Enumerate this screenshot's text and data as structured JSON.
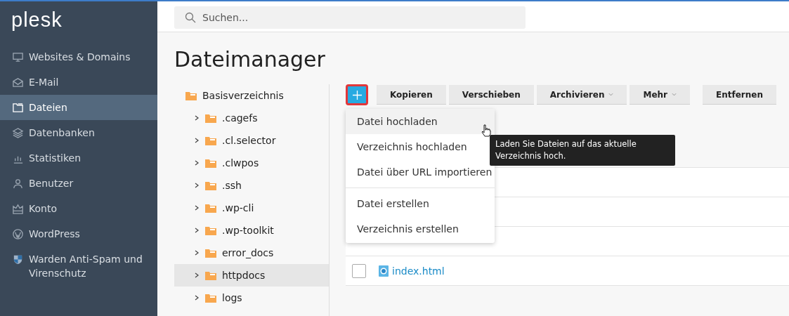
{
  "sidebar": {
    "logo": "plesk",
    "items": [
      {
        "label": "Websites & Domains",
        "selected": false
      },
      {
        "label": "E-Mail",
        "selected": false
      },
      {
        "label": "Dateien",
        "selected": true
      },
      {
        "label": "Datenbanken",
        "selected": false
      },
      {
        "label": "Statistiken",
        "selected": false
      },
      {
        "label": "Benutzer",
        "selected": false
      },
      {
        "label": "Konto",
        "selected": false
      },
      {
        "label": "WordPress",
        "selected": false
      },
      {
        "label": "Warden Anti-Spam und Virenschutz",
        "selected": false
      }
    ]
  },
  "search": {
    "placeholder": "Suchen..."
  },
  "page_title": "Dateimanager",
  "tree": {
    "label": "Basisverzeichnis",
    "selected": false,
    "children": [
      {
        "label": ".cagefs",
        "expanded": false,
        "selected": false
      },
      {
        "label": ".cl.selector",
        "expanded": false,
        "selected": false
      },
      {
        "label": ".clwpos",
        "expanded": false,
        "selected": false
      },
      {
        "label": ".ssh",
        "expanded": false,
        "selected": false
      },
      {
        "label": ".wp-cli",
        "expanded": false,
        "selected": false
      },
      {
        "label": ".wp-toolkit",
        "expanded": false,
        "selected": false
      },
      {
        "label": "error_docs",
        "expanded": false,
        "selected": false
      },
      {
        "label": "httpdocs",
        "expanded": false,
        "selected": true
      },
      {
        "label": "logs",
        "expanded": false,
        "selected": false
      }
    ]
  },
  "toolbar": {
    "add_button": {
      "focused": true
    },
    "buttons": [
      {
        "label": "Kopieren",
        "kind": "button"
      },
      {
        "label": "Verschieben",
        "kind": "button"
      },
      {
        "label": "Archivieren",
        "kind": "dropdown"
      },
      {
        "label": "Mehr",
        "kind": "dropdown"
      },
      {
        "label": "Entfernen",
        "kind": "button"
      }
    ]
  },
  "add_menu": {
    "groups": [
      [
        {
          "label": "Datei hochladen",
          "selected": true
        },
        {
          "label": "Verzeichnis hochladen",
          "selected": false
        },
        {
          "label": "Datei über URL importieren",
          "selected": false
        }
      ],
      [
        {
          "label": "Datei erstellen",
          "selected": false
        },
        {
          "label": "Verzeichnis erstellen",
          "selected": false
        }
      ]
    ]
  },
  "tooltip": "Laden Sie Dateien auf das aktuelle Verzeichnis hoch.",
  "files": [
    {
      "name": "index.html",
      "checked": false
    }
  ]
}
